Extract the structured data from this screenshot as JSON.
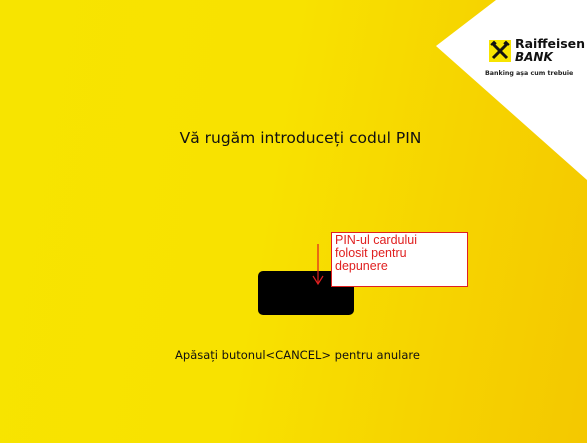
{
  "bank": {
    "name": "Raiffeisen",
    "sub": "BANK",
    "slogan": "Banking așa cum trebuie",
    "logo_icon": "crossed-horses-icon"
  },
  "screen": {
    "prompt": "Vă rugăm introduceți codul PIN",
    "cancel_hint": "Apăsați butonul<CANCEL> pentru anulare"
  },
  "annotation": {
    "lines": [
      "PIN-ul cardului",
      "folosit pentru",
      "depunere"
    ]
  },
  "colors": {
    "background": "#f7e400",
    "annotation_red": "#e02020",
    "pin_box": "#000000"
  }
}
